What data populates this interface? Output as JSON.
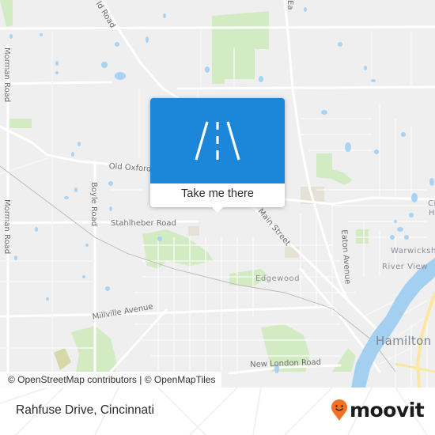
{
  "map": {
    "road_labels": [
      {
        "text": "Morman Road",
        "id": "morman-road-north"
      },
      {
        "text": "Morman Road",
        "id": "morman-road-south"
      },
      {
        "text": "ld Road",
        "id": "oxford-road-top"
      },
      {
        "text": "Old Oxford",
        "id": "old-oxford-road"
      },
      {
        "text": "Boyle Road",
        "id": "boyle-road"
      },
      {
        "text": "Stahlheber Road",
        "id": "stahlheber-road"
      },
      {
        "text": "Main Street",
        "id": "main-street"
      },
      {
        "text": "Eaton Avenue",
        "id": "eaton-avenue"
      },
      {
        "text": "Millville Avenue",
        "id": "millville-avenue"
      },
      {
        "text": "New London Road",
        "id": "new-london-road"
      },
      {
        "text": "Ea",
        "id": "eaton-avenue-top"
      }
    ],
    "place_labels": [
      {
        "text": "Edgewood",
        "id": "edgewood"
      },
      {
        "text": "Warwicksh",
        "id": "warwickshire"
      },
      {
        "text": "River View",
        "id": "river-view"
      },
      {
        "text": "Hamilton",
        "id": "hamilton"
      },
      {
        "text": "Ci",
        "id": "city-partial-1"
      },
      {
        "text": "H",
        "id": "city-partial-2"
      }
    ],
    "attribution": "© OpenStreetMap contributors | © OpenMapTiles",
    "colors": {
      "land": "#efefef",
      "road": "#ffffff",
      "park": "#cfe9bf",
      "water": "#a9d3f2",
      "river": "#a3cff0",
      "highway": "#fbe9a8",
      "popup_accent": "#1c86d8"
    }
  },
  "popup": {
    "icon": "road-icon",
    "action_label": "Take me there"
  },
  "footer": {
    "location_name": "Rahfuse Drive, Cincinnati",
    "brand_name": "moovit",
    "brand_color": "#f36f21"
  }
}
